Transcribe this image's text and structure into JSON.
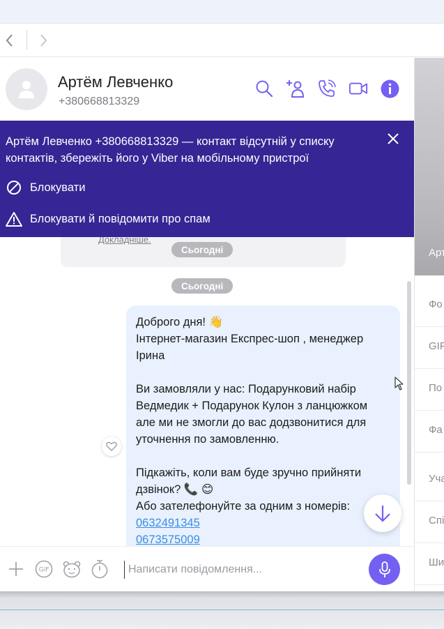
{
  "contact": {
    "name": "Артём Левченко",
    "phone": "+380668813329"
  },
  "banner": {
    "text": "Артём Левченко +380668813329 — контакт відсутній у списку контактів, збережіть його у Viber на мобільному пристрої",
    "block_label": "Блокувати",
    "block_spam_label": "Блокувати й повідомити про спам"
  },
  "history": {
    "link": "Докладніше.",
    "date_pill_1": "Сьогодні",
    "date_pill_2": "Сьогодні"
  },
  "message": {
    "lines": [
      "Доброго дня! 👋",
      "Інтернет-магазин Експрес-шоп , менеджер",
      "Ірина",
      "",
      "Ви замовляли у нас: Подарунковий набір",
      "Ведмедик + Подарунок Кулон з ланцюжком",
      "але ми не змогли до вас додзвонитися для",
      "уточнення по замовленню.",
      "",
      "Підкажіть, коли вам буде зручно прийняти",
      "дзвінок? 📞 😊",
      "Або зателефонуйте за одним з номерів:"
    ],
    "phones": [
      "0632491345",
      "0673575009"
    ]
  },
  "composer": {
    "placeholder": "Написати повідомлення..."
  },
  "right_panel": {
    "photo_label": "Арт",
    "rows": [
      "Фо",
      "GIF",
      "По",
      "Фа",
      "Уча",
      "Спі",
      "Ши"
    ]
  },
  "colors": {
    "accent": "#7360f2",
    "banner_bg": "#362594",
    "bubble_bg": "#e8f1fd"
  }
}
